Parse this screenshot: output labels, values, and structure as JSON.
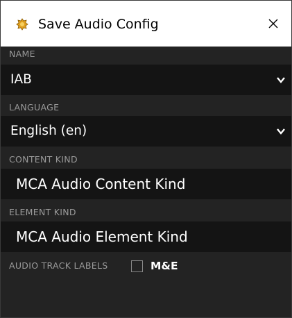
{
  "window": {
    "title": "Save Audio Config",
    "app_icon": "gear-app-icon",
    "close_icon": "close-icon"
  },
  "fields": {
    "name": {
      "label": "NAME",
      "value": "IAB",
      "icon": "chevron-down-icon"
    },
    "language": {
      "label": "LANGUAGE",
      "value": "English (en)",
      "icon": "chevron-down-icon"
    },
    "content_kind": {
      "label": "CONTENT KIND",
      "value": "MCA Audio Content Kind"
    },
    "element_kind": {
      "label": "ELEMENT KIND",
      "value": "MCA Audio Element Kind"
    },
    "audio_track_labels": {
      "label": "AUDIO TRACK LABELS",
      "option_label": "M&E",
      "checked": false
    }
  },
  "colors": {
    "background": "#232323",
    "field_background": "#141414",
    "label_text": "#9a9a9a",
    "value_text": "#ffffff",
    "titlebar": "#ffffff",
    "icon_accent": "#e0a020"
  }
}
